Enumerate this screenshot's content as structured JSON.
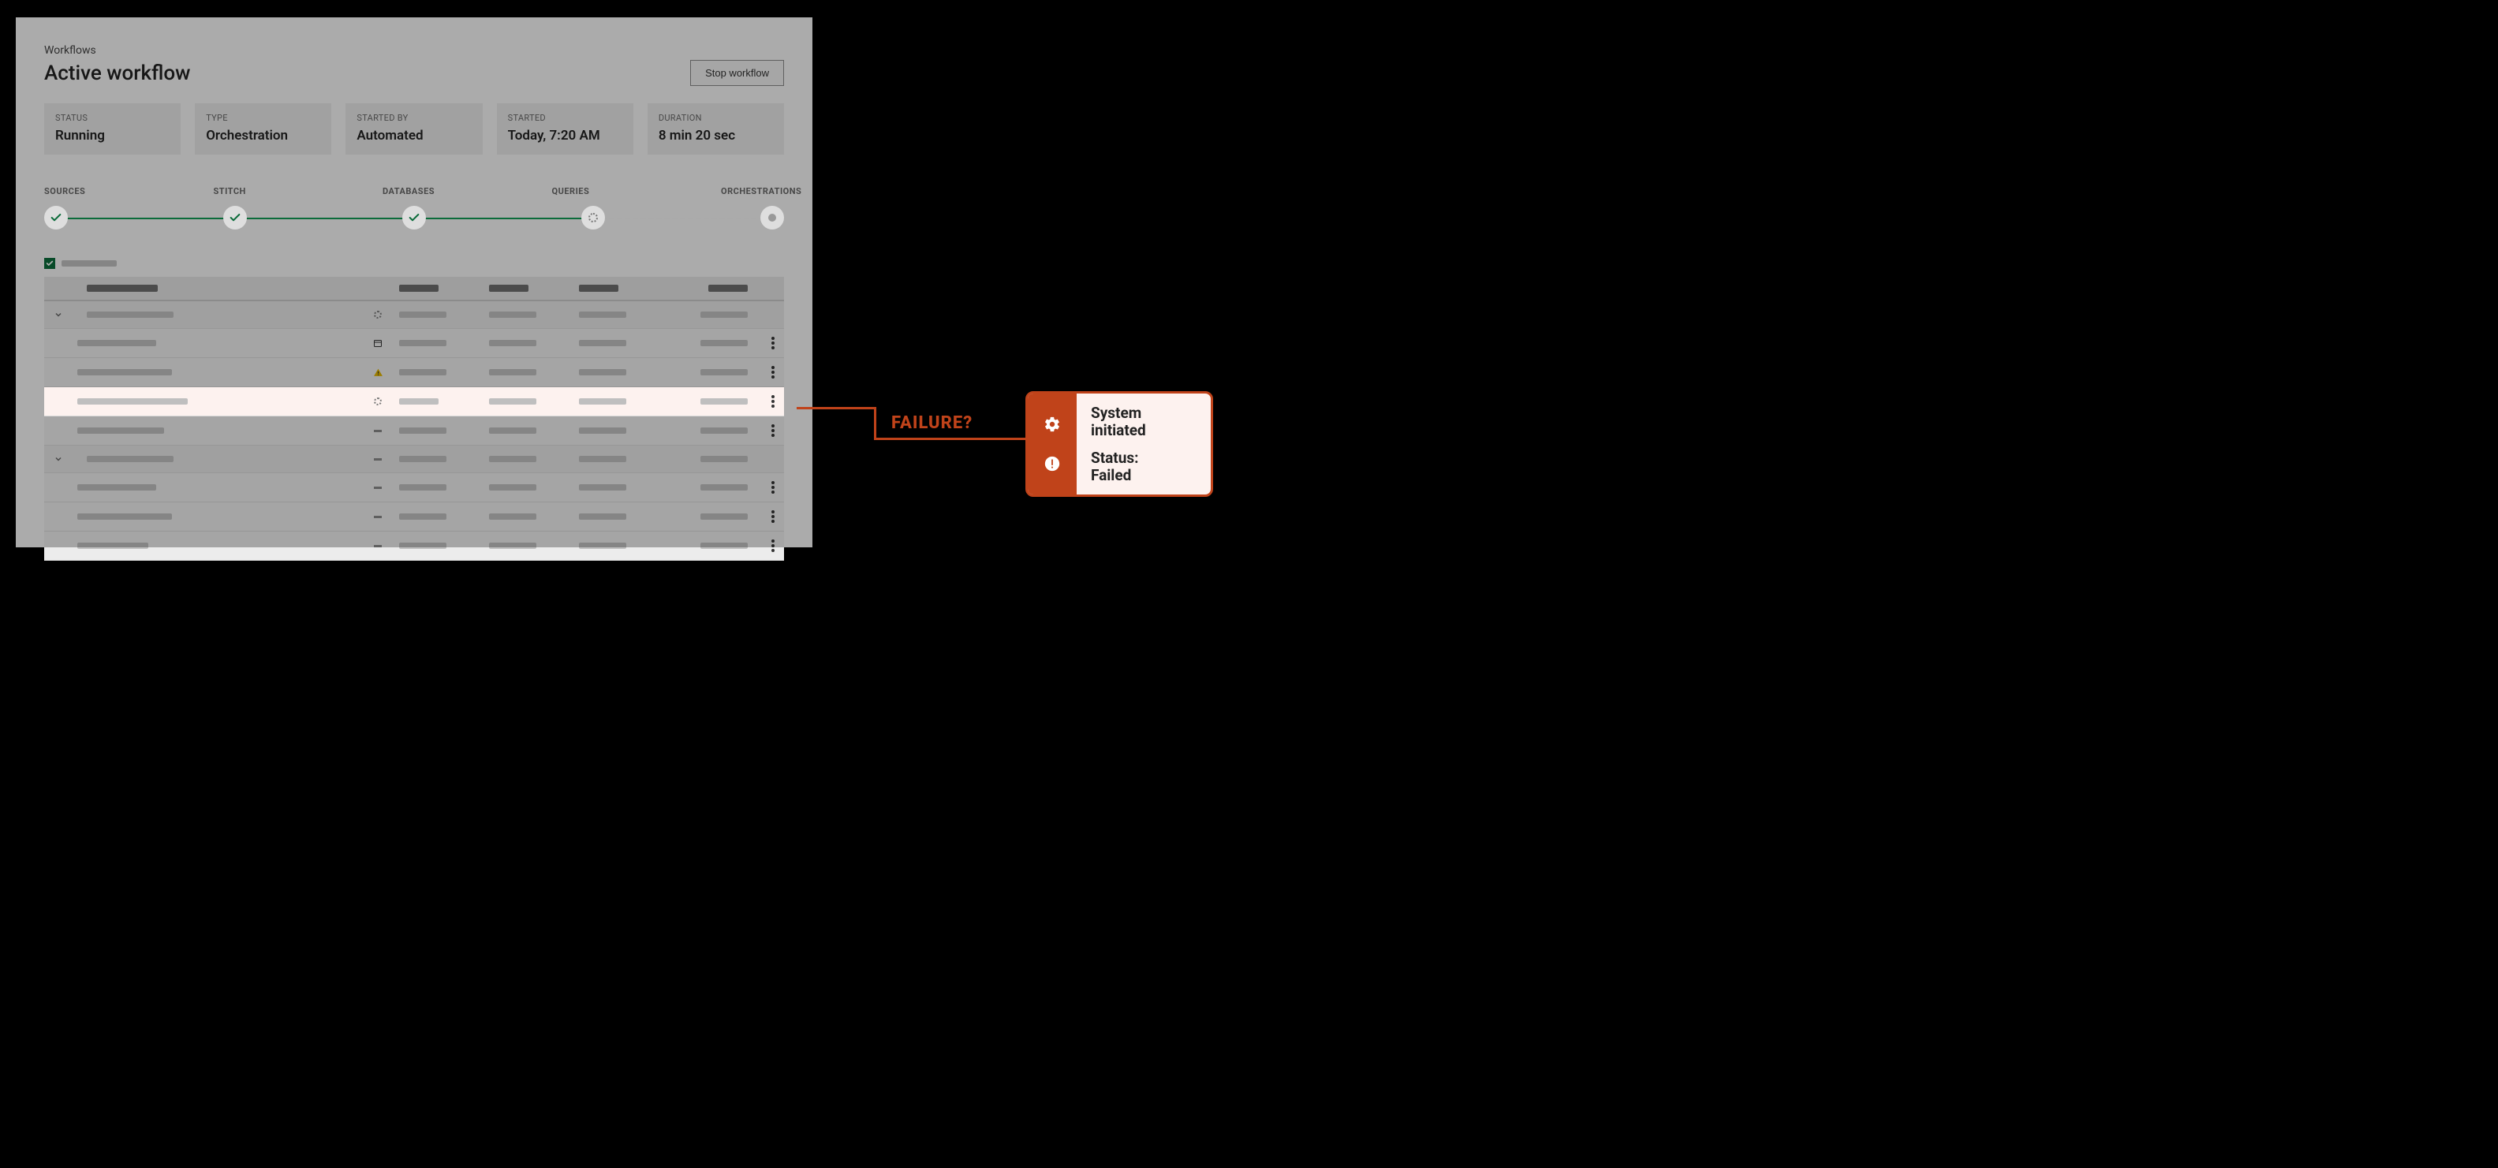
{
  "breadcrumb": "Workflows",
  "title": "Active workflow",
  "stop_button": "Stop workflow",
  "cards": [
    {
      "label": "STATUS",
      "value": "Running"
    },
    {
      "label": "TYPE",
      "value": "Orchestration"
    },
    {
      "label": "STARTED BY",
      "value": "Automated"
    },
    {
      "label": "STARTED",
      "value": "Today, 7:20 AM"
    },
    {
      "label": "DURATION",
      "value": "8 min 20 sec"
    }
  ],
  "pipeline": {
    "steps": [
      "SOURCES",
      "STITCH",
      "DATABASES",
      "QUERIES",
      "ORCHESTRATIONS"
    ],
    "states": [
      "done",
      "done",
      "done",
      "running",
      "pending"
    ]
  },
  "annotation": {
    "label": "FAILURE?",
    "items": [
      {
        "icon": "gear",
        "text_l1": "System",
        "text_l2": "initiated"
      },
      {
        "icon": "alert",
        "text_l1": "Status:",
        "text_l2": "Failed"
      }
    ]
  }
}
